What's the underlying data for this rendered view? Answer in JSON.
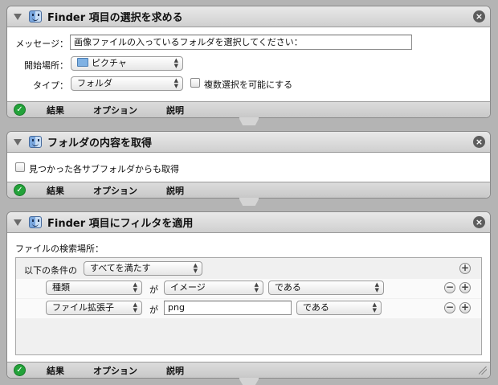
{
  "actions": [
    {
      "title": "Finder 項目の選択を求める",
      "fields": {
        "message_label": "メッセージ：",
        "message_value": "画像ファイルの入っているフォルダを選択してください：",
        "start_label": "開始場所：",
        "start_value": "ピクチャ",
        "type_label": "タイプ：",
        "type_value": "フォルダ",
        "multi_select_label": "複数選択を可能にする"
      },
      "footer": {
        "results": "結果",
        "options": "オプション",
        "description": "説明"
      }
    },
    {
      "title": "フォルダの内容を取得",
      "fields": {
        "subfolders_label": "見つかった各サブフォルダからも取得"
      },
      "footer": {
        "results": "結果",
        "options": "オプション",
        "description": "説明"
      }
    },
    {
      "title": "Finder 項目にフィルタを適用",
      "fields": {
        "search_location_label": "ファイルの検索場所：",
        "condition_prefix": "以下の条件の",
        "condition_match": "すべてを満たす",
        "rows": [
          {
            "attribute": "種類",
            "particle": "が",
            "value": "イメージ",
            "operator": "である"
          },
          {
            "attribute": "ファイル拡張子",
            "particle": "が",
            "value": "png",
            "operator": "である"
          }
        ]
      },
      "footer": {
        "results": "結果",
        "options": "オプション",
        "description": "説明"
      }
    }
  ],
  "icons": {
    "close": "⊗",
    "ok": "✓",
    "add": "+",
    "remove": "−"
  }
}
